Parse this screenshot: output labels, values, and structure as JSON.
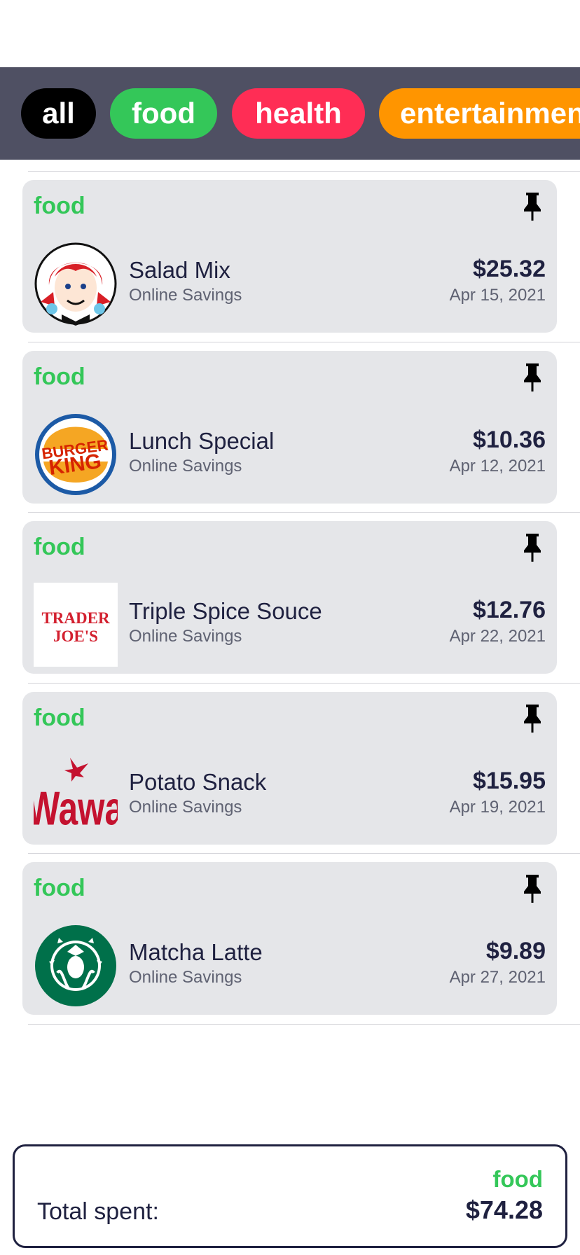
{
  "filters": {
    "all": "all",
    "food": "food",
    "health": "health",
    "entertainment": "entertainment"
  },
  "colors": {
    "all": "#000000",
    "food": "#34c759",
    "health": "#ff2d55",
    "entertainment": "#ff9500",
    "filter_bar": "#4f5063",
    "card_bg": "#e5e6e9"
  },
  "items": [
    {
      "category": "food",
      "name": "Salad Mix",
      "source": "Online Savings",
      "amount": "$25.32",
      "date": "Apr 15, 2021",
      "logo": "wendys-logo",
      "pin_icon": "pin-icon"
    },
    {
      "category": "food",
      "name": "Lunch Special",
      "source": "Online Savings",
      "amount": "$10.36",
      "date": "Apr 12, 2021",
      "logo": "burger-king-logo",
      "logo_text": [
        "BURGER",
        "KING"
      ],
      "pin_icon": "pin-icon"
    },
    {
      "category": "food",
      "name": "Triple Spice Souce",
      "source": "Online Savings",
      "amount": "$12.76",
      "date": "Apr 22, 2021",
      "logo": "trader-joes-logo",
      "logo_text": [
        "TRADER",
        "JOE'S"
      ],
      "pin_icon": "pin-icon"
    },
    {
      "category": "food",
      "name": "Potato Snack",
      "source": "Online Savings",
      "amount": "$15.95",
      "date": "Apr 19, 2021",
      "logo": "wawa-logo",
      "logo_text": [
        "Wawa"
      ],
      "pin_icon": "pin-icon"
    },
    {
      "category": "food",
      "name": "Matcha Latte",
      "source": "Online Savings",
      "amount": "$9.89",
      "date": "Apr 27, 2021",
      "logo": "starbucks-logo",
      "pin_icon": "pin-icon"
    }
  ],
  "summary": {
    "category": "food",
    "label": "Total spent:",
    "total": "$74.28"
  }
}
